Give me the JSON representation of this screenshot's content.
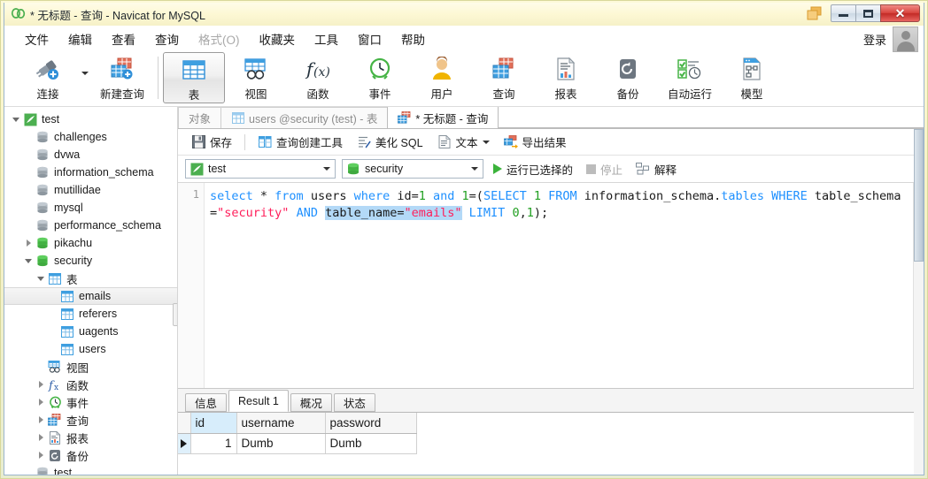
{
  "window": {
    "title": "* 无标题 - 查询 - Navicat for MySQL",
    "logo_icon": "navicat-logo-icon",
    "restore_icon": "restore-windows-icon",
    "minimize_label": "",
    "maximize_label": "",
    "close_label": "✕"
  },
  "menubar": {
    "items": [
      {
        "label": "文件",
        "disabled": false
      },
      {
        "label": "编辑",
        "disabled": false
      },
      {
        "label": "查看",
        "disabled": false
      },
      {
        "label": "查询",
        "disabled": false
      },
      {
        "label": "格式(O)",
        "disabled": true
      },
      {
        "label": "收藏夹",
        "disabled": false
      },
      {
        "label": "工具",
        "disabled": false
      },
      {
        "label": "窗口",
        "disabled": false
      },
      {
        "label": "帮助",
        "disabled": false
      }
    ],
    "login_label": "登录",
    "avatar_icon": "user-avatar-icon"
  },
  "toolbar": {
    "items": [
      {
        "label": "连接",
        "icon": "connection-plug-icon",
        "selected": false,
        "has_dropdown": true
      },
      {
        "label": "新建查询",
        "icon": "new-query-icon",
        "selected": false,
        "has_dropdown": false
      },
      {
        "label": "表",
        "icon": "table-icon",
        "selected": true,
        "has_dropdown": false
      },
      {
        "label": "视图",
        "icon": "view-icon",
        "selected": false,
        "has_dropdown": false
      },
      {
        "label": "函数",
        "icon": "function-fx-icon",
        "selected": false,
        "has_dropdown": false
      },
      {
        "label": "事件",
        "icon": "event-clock-icon",
        "selected": false,
        "has_dropdown": false
      },
      {
        "label": "用户",
        "icon": "user-icon",
        "selected": false,
        "has_dropdown": false
      },
      {
        "label": "查询",
        "icon": "query-icon",
        "selected": false,
        "has_dropdown": false
      },
      {
        "label": "报表",
        "icon": "report-icon",
        "selected": false,
        "has_dropdown": false
      },
      {
        "label": "备份",
        "icon": "backup-icon",
        "selected": false,
        "has_dropdown": false
      },
      {
        "label": "自动运行",
        "icon": "automation-icon",
        "selected": false,
        "has_dropdown": false
      },
      {
        "label": "模型",
        "icon": "model-icon",
        "selected": false,
        "has_dropdown": false
      }
    ]
  },
  "sidebar": {
    "nodes": [
      {
        "label": "test",
        "icon": "connection-icon",
        "indent": 0,
        "expander": "down",
        "selected": false
      },
      {
        "label": "challenges",
        "icon": "database-gray-icon",
        "indent": 1,
        "expander": "none",
        "selected": false
      },
      {
        "label": "dvwa",
        "icon": "database-gray-icon",
        "indent": 1,
        "expander": "none",
        "selected": false
      },
      {
        "label": "information_schema",
        "icon": "database-gray-icon",
        "indent": 1,
        "expander": "none",
        "selected": false
      },
      {
        "label": "mutillidae",
        "icon": "database-gray-icon",
        "indent": 1,
        "expander": "none",
        "selected": false
      },
      {
        "label": "mysql",
        "icon": "database-gray-icon",
        "indent": 1,
        "expander": "none",
        "selected": false
      },
      {
        "label": "performance_schema",
        "icon": "database-gray-icon",
        "indent": 1,
        "expander": "none",
        "selected": false
      },
      {
        "label": "pikachu",
        "icon": "database-green-icon",
        "indent": 1,
        "expander": "right",
        "selected": false
      },
      {
        "label": "security",
        "icon": "database-green-icon",
        "indent": 1,
        "expander": "down",
        "selected": false
      },
      {
        "label": "表",
        "icon": "table-icon",
        "indent": 2,
        "expander": "down",
        "selected": false
      },
      {
        "label": "emails",
        "icon": "table-icon",
        "indent": 3,
        "expander": "none",
        "selected": true
      },
      {
        "label": "referers",
        "icon": "table-icon",
        "indent": 3,
        "expander": "none",
        "selected": false
      },
      {
        "label": "uagents",
        "icon": "table-icon",
        "indent": 3,
        "expander": "none",
        "selected": false
      },
      {
        "label": "users",
        "icon": "table-icon",
        "indent": 3,
        "expander": "none",
        "selected": false
      },
      {
        "label": "视图",
        "icon": "view-icon",
        "indent": 2,
        "expander": "none",
        "selected": false
      },
      {
        "label": "函数",
        "icon": "function-fx-icon",
        "indent": 2,
        "expander": "right",
        "selected": false
      },
      {
        "label": "事件",
        "icon": "event-clock-icon",
        "indent": 2,
        "expander": "right",
        "selected": false
      },
      {
        "label": "查询",
        "icon": "query-icon",
        "indent": 2,
        "expander": "right",
        "selected": false
      },
      {
        "label": "报表",
        "icon": "report-icon",
        "indent": 2,
        "expander": "right",
        "selected": false
      },
      {
        "label": "备份",
        "icon": "backup-icon",
        "indent": 2,
        "expander": "right",
        "selected": false
      },
      {
        "label": "test",
        "icon": "database-gray-icon",
        "indent": 1,
        "expander": "none",
        "selected": false
      }
    ]
  },
  "tabs": {
    "items": [
      {
        "label": "对象",
        "icon": "none",
        "active": false
      },
      {
        "label": "users @security (test) - 表",
        "icon": "table-icon",
        "active": false
      },
      {
        "label": "* 无标题 - 查询",
        "icon": "query-icon",
        "active": true
      }
    ]
  },
  "actionbar": {
    "items": [
      {
        "label": "保存",
        "icon": "save-icon",
        "dropdown": false
      },
      {
        "label": "查询创建工具",
        "icon": "query-builder-icon",
        "dropdown": false
      },
      {
        "label": "美化 SQL",
        "icon": "beautify-sql-icon",
        "dropdown": false
      },
      {
        "label": "文本",
        "icon": "text-icon",
        "dropdown": true
      },
      {
        "label": "导出结果",
        "icon": "export-result-icon",
        "dropdown": false
      }
    ]
  },
  "querybar": {
    "connection": {
      "value": "test",
      "icon": "connection-icon"
    },
    "database": {
      "value": "security",
      "icon": "database-green-icon"
    },
    "run_label": "运行已选择的",
    "run_icon": "play-icon",
    "stop_label": "停止",
    "stop_icon": "stop-icon",
    "explain_label": "解释",
    "explain_icon": "explain-icon"
  },
  "editor": {
    "line_numbers": [
      "1"
    ],
    "sql_full": "select * from users where id=1 and 1=(SELECT 1 FROM information_schema.tables WHERE table_schema=\"security\" AND table_name=\"emails\" LIMIT 0,1);",
    "tokens": [
      {
        "t": "select",
        "c": "kw"
      },
      {
        "t": " * ",
        "c": "ident"
      },
      {
        "t": "from",
        "c": "kw"
      },
      {
        "t": " users ",
        "c": "ident"
      },
      {
        "t": "where",
        "c": "kw"
      },
      {
        "t": " id=",
        "c": "ident"
      },
      {
        "t": "1",
        "c": "num"
      },
      {
        "t": " and ",
        "c": "kw"
      },
      {
        "t": "1",
        "c": "num"
      },
      {
        "t": "=(",
        "c": "ident"
      },
      {
        "t": "SELECT",
        "c": "kw"
      },
      {
        "t": " ",
        "c": "ident"
      },
      {
        "t": "1",
        "c": "num"
      },
      {
        "t": " ",
        "c": "ident"
      },
      {
        "t": "FROM",
        "c": "kw"
      },
      {
        "t": " information_schema.",
        "c": "ident"
      },
      {
        "t": "tables",
        "c": "kw"
      },
      {
        "t": " ",
        "c": "ident"
      },
      {
        "t": "WHERE",
        "c": "kw"
      },
      {
        "t": " table_schema=",
        "c": "ident"
      },
      {
        "t": "\"security\"",
        "c": "str"
      },
      {
        "t": " ",
        "c": "ident"
      },
      {
        "t": "AND",
        "c": "kw"
      },
      {
        "t": " ",
        "c": "ident"
      },
      {
        "t": "table_name=",
        "c": "ident-hl"
      },
      {
        "t": "\"emails\"",
        "c": "str-hl"
      },
      {
        "t": " ",
        "c": "ident"
      },
      {
        "t": "LIMIT",
        "c": "kw"
      },
      {
        "t": " ",
        "c": "ident"
      },
      {
        "t": "0",
        "c": "num"
      },
      {
        "t": ",",
        "c": "ident"
      },
      {
        "t": "1",
        "c": "num"
      },
      {
        "t": ");",
        "c": "ident"
      }
    ]
  },
  "results": {
    "tabs": [
      {
        "label": "信息",
        "active": false
      },
      {
        "label": "Result 1",
        "active": true
      },
      {
        "label": "概况",
        "active": false
      },
      {
        "label": "状态",
        "active": false
      }
    ],
    "columns": [
      "id",
      "username",
      "password"
    ],
    "key_column": "id",
    "rows": [
      {
        "mark": "current",
        "id": "1",
        "username": "Dumb",
        "password": "Dumb"
      }
    ]
  },
  "colors": {
    "frame": "#f7f2c4",
    "accent_blue": "#1e90ff",
    "keyword": "#1e90ff",
    "string": "#ff1e5a",
    "number": "#22a022",
    "selection": "#b3d9f7",
    "key_header": "#d7edfb",
    "close_red": "#d8453f"
  }
}
